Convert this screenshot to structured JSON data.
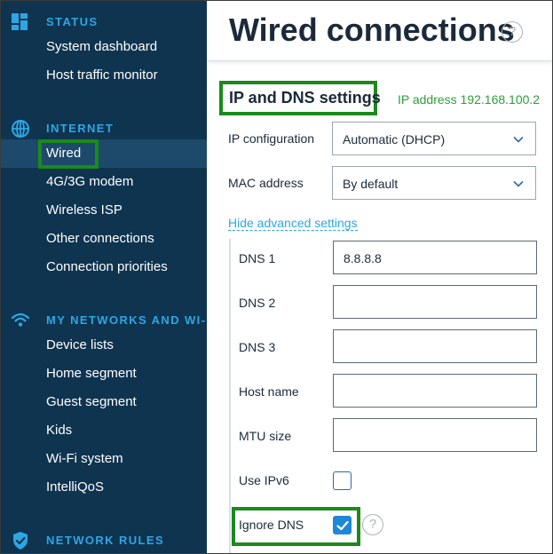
{
  "sidebar": {
    "sections": [
      {
        "title": "STATUS",
        "icon": "dashboard-icon",
        "items": [
          {
            "label": "System dashboard"
          },
          {
            "label": "Host traffic monitor"
          }
        ]
      },
      {
        "title": "INTERNET",
        "icon": "globe-icon",
        "items": [
          {
            "label": "Wired",
            "active": true
          },
          {
            "label": "4G/3G modem"
          },
          {
            "label": "Wireless ISP"
          },
          {
            "label": "Other connections"
          },
          {
            "label": "Connection priorities"
          }
        ]
      },
      {
        "title": "MY NETWORKS AND WI-FI",
        "icon": "wifi-icon",
        "items": [
          {
            "label": "Device lists"
          },
          {
            "label": "Home segment"
          },
          {
            "label": "Guest segment"
          },
          {
            "label": "Kids"
          },
          {
            "label": "Wi-Fi system"
          },
          {
            "label": "IntelliQoS"
          }
        ]
      },
      {
        "title": "NETWORK RULES",
        "icon": "shield-icon",
        "items": []
      }
    ]
  },
  "header": {
    "title": "Wired connections",
    "help_glyph": "?"
  },
  "settings": {
    "title": "IP and DNS settings",
    "ip_status": "IP address 192.168.100.2",
    "ip_configuration": {
      "label": "IP configuration",
      "value": "Automatic (DHCP)"
    },
    "mac_address": {
      "label": "MAC address",
      "value": "By default"
    },
    "advanced_link": "Hide advanced settings",
    "dns1": {
      "label": "DNS 1",
      "value": "8.8.8.8"
    },
    "dns2": {
      "label": "DNS 2",
      "value": ""
    },
    "dns3": {
      "label": "DNS 3",
      "value": ""
    },
    "host_name": {
      "label": "Host name",
      "value": ""
    },
    "mtu_size": {
      "label": "MTU size",
      "value": ""
    },
    "use_ipv6": {
      "label": "Use IPv6",
      "checked": false
    },
    "ignore_dns": {
      "label": "Ignore DNS",
      "checked": true,
      "help_glyph": "?"
    }
  },
  "colors": {
    "sidebar_bg": "#0f3450",
    "section_title": "#2ea6e3",
    "highlight_green": "#1b8a1b",
    "status_green": "#2e9e3a",
    "link_blue": "#2ea6e3",
    "checkbox_blue": "#1e88d4"
  }
}
